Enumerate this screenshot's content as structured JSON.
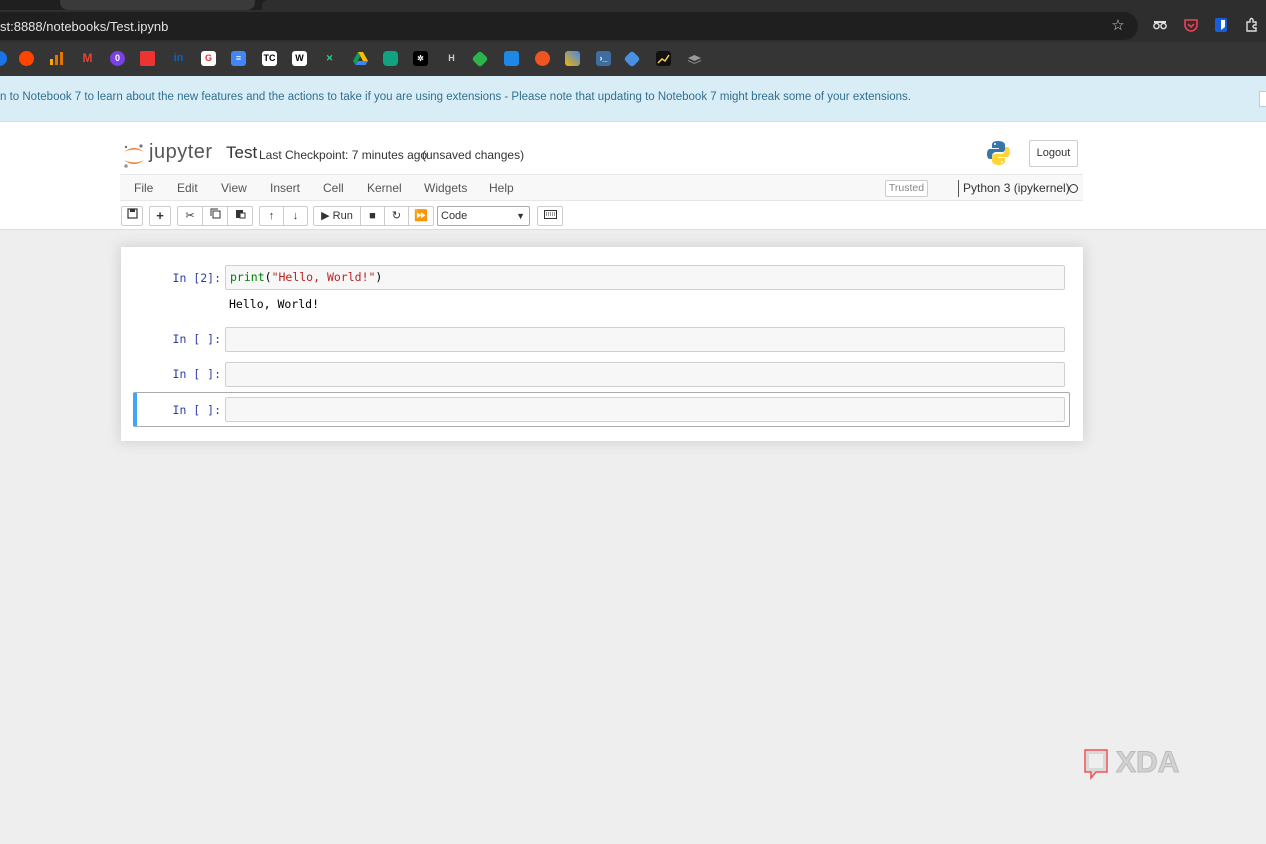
{
  "browser": {
    "url": "st:8888/notebooks/Test.ipynb"
  },
  "banner": {
    "text": "n to Notebook 7 to learn about the new features and the actions to take if you are using extensions - Please note that updating to Notebook 7 might break some of your extensions."
  },
  "header": {
    "logo_text": "jupyter",
    "notebook_name": "Test",
    "checkpoint": "Last Checkpoint: 7 minutes ago",
    "unsaved": "(unsaved changes)",
    "logout_label": "Logout"
  },
  "menu": {
    "items": [
      "File",
      "Edit",
      "View",
      "Insert",
      "Cell",
      "Kernel",
      "Widgets",
      "Help"
    ],
    "trusted": "Trusted",
    "kernel": "Python 3 (ipykernel)"
  },
  "toolbar": {
    "run_label": "Run",
    "cell_type": "Code"
  },
  "cells": [
    {
      "prompt": "In [2]:",
      "code_fn": "print",
      "code_open": "(",
      "code_str": "\"Hello, World!\"",
      "code_close": ")",
      "output": "Hello, World!"
    },
    {
      "prompt": "In [ ]:"
    },
    {
      "prompt": "In [ ]:"
    },
    {
      "prompt": "In [ ]:"
    }
  ],
  "watermark": {
    "text": "XDA"
  }
}
